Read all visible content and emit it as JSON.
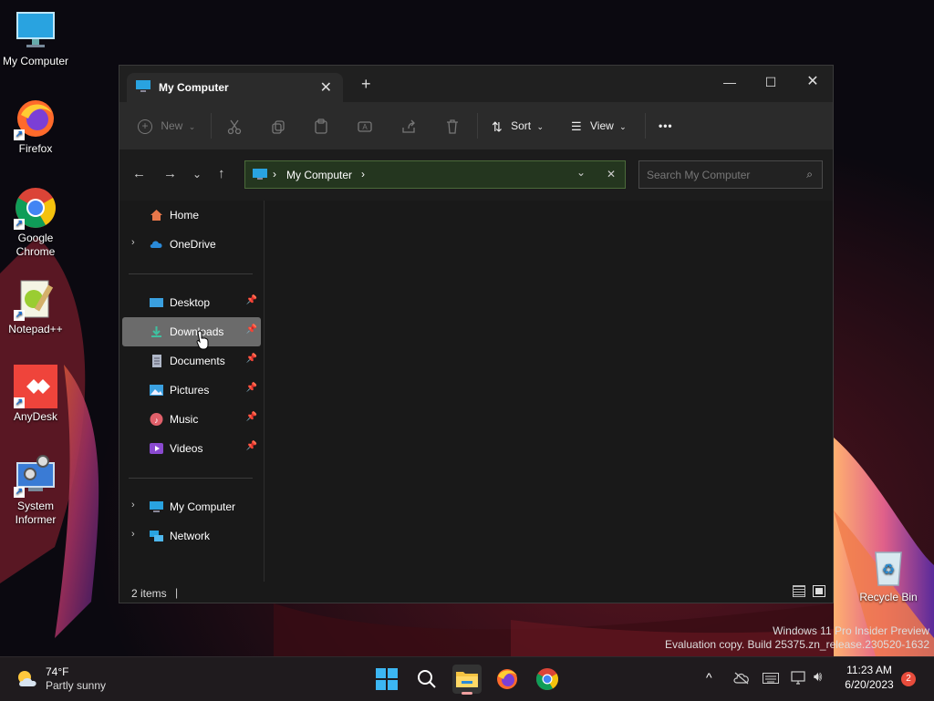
{
  "desktop": {
    "icons": [
      {
        "label": "My Computer",
        "icon": "monitor-icon"
      },
      {
        "label": "Firefox",
        "icon": "firefox-icon"
      },
      {
        "label": "Google Chrome",
        "icon": "chrome-icon"
      },
      {
        "label": "Notepad++",
        "icon": "notepad-plus-plus-icon"
      },
      {
        "label": "AnyDesk",
        "icon": "anydesk-icon"
      },
      {
        "label": "System Informer",
        "icon": "system-informer-icon"
      },
      {
        "label": "Recycle Bin",
        "icon": "recycle-bin-icon"
      }
    ],
    "watermark_line1": "Windows 11 Pro Insider Preview",
    "watermark_line2": "Evaluation copy. Build 25375.zn_release.230520-1632"
  },
  "explorer": {
    "tab_title": "My Computer",
    "new_tab": "+",
    "toolbar": {
      "new_label": "New",
      "sort_label": "Sort",
      "view_label": "View",
      "more_label": "•••"
    },
    "address": {
      "location": "My Computer",
      "search_placeholder": "Search My Computer"
    },
    "nav": {
      "home": "Home",
      "onedrive": "OneDrive",
      "pinned": [
        {
          "label": "Desktop",
          "icon": "desktop-icon"
        },
        {
          "label": "Downloads",
          "icon": "download-icon"
        },
        {
          "label": "Documents",
          "icon": "document-icon"
        },
        {
          "label": "Pictures",
          "icon": "picture-icon"
        },
        {
          "label": "Music",
          "icon": "music-icon"
        },
        {
          "label": "Videos",
          "icon": "video-icon"
        }
      ],
      "my_computer": "My Computer",
      "network": "Network"
    },
    "status": "2 items"
  },
  "taskbar": {
    "weather_temp": "74°F",
    "weather_desc": "Partly sunny",
    "time": "11:23 AM",
    "date": "6/20/2023",
    "notification_count": "2"
  },
  "colors": {
    "accent": "#4cc2ff",
    "address_bg": "#24361f",
    "selected_nav": "#6b6b6b",
    "badge": "#e74c3c"
  }
}
